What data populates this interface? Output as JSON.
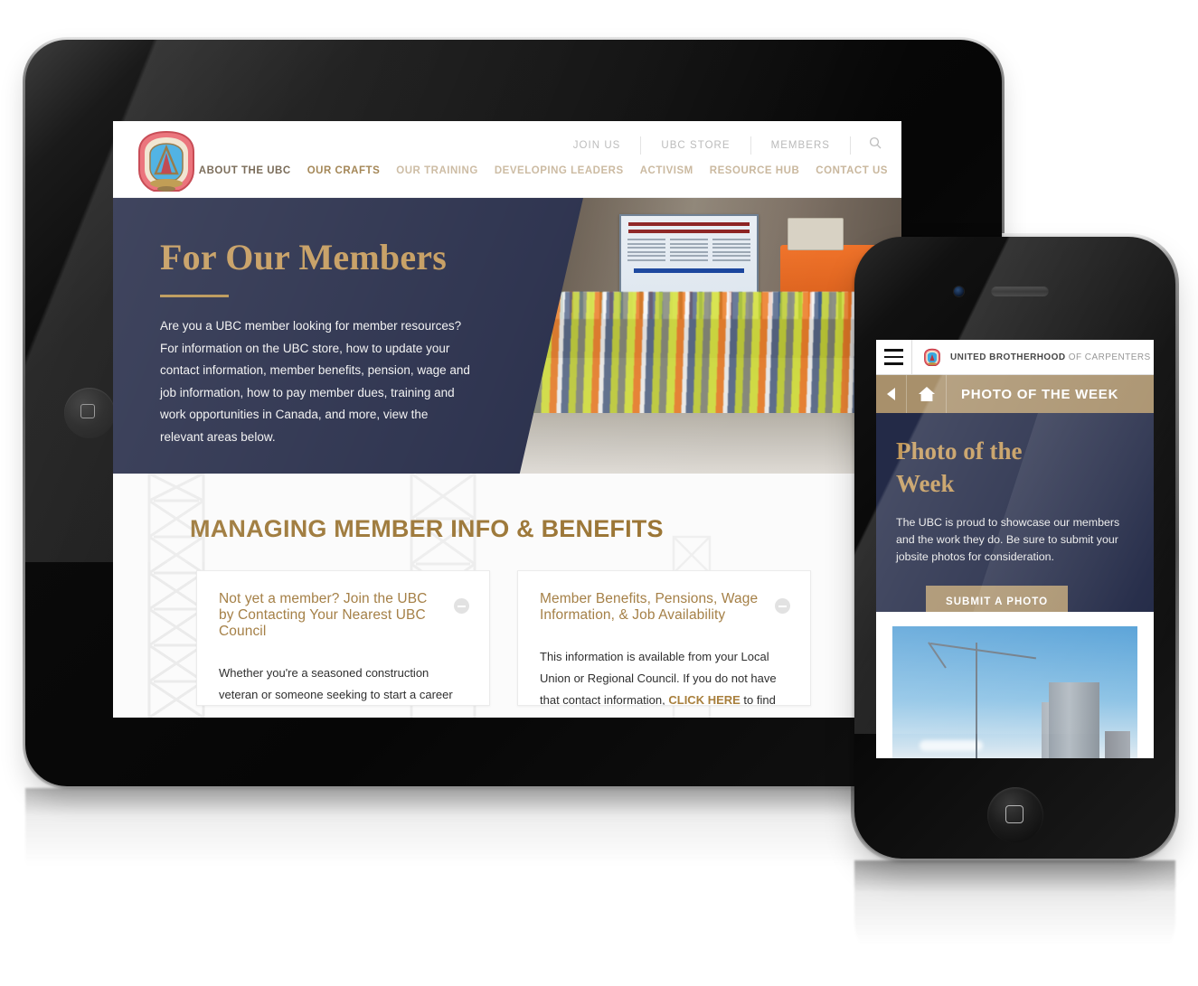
{
  "scene": {
    "description": "Responsive website mockup shown on a tablet and a smartphone",
    "devices": [
      "tablet",
      "phone"
    ]
  },
  "colors": {
    "navy": "#242a47",
    "gold": "#c49a5b",
    "bronze": "#a8906b",
    "heading_brown": "#9a7433",
    "card_title": "#a58047",
    "link_gold": "#a87f3c",
    "crest_red": "#e0575f",
    "crest_blue": "#3aa9e0"
  },
  "tablet": {
    "site_header": {
      "logo_name": "ubc-crest-logo",
      "top_links": [
        {
          "label": "JOIN US"
        },
        {
          "label": "UBC STORE"
        },
        {
          "label": "MEMBERS"
        }
      ],
      "search_icon": "search-icon",
      "main_nav": [
        {
          "label": "ABOUT THE UBC",
          "state": "dark"
        },
        {
          "label": "OUR CRAFTS",
          "state": "active"
        },
        {
          "label": "OUR TRAINING",
          "state": "normal"
        },
        {
          "label": "DEVELOPING LEADERS",
          "state": "normal"
        },
        {
          "label": "ACTIVISM",
          "state": "normal"
        },
        {
          "label": "RESOURCE HUB",
          "state": "normal"
        },
        {
          "label": "CONTACT US",
          "state": "normal"
        }
      ]
    },
    "hero": {
      "title": "For Our Members",
      "body": "Are you a UBC member looking for member resources? For information on the UBC store, how to update your contact information, member benefits, pension, wage and job information, how to pay member dues, training and work opportunities in Canada, and more, view the relevant areas below.",
      "photo_alt": "Large group of construction workers in hard hats and high-visibility vests posed in front of a memorial sign",
      "photo_sign_text": "WE WILL NEVER FORGET OUR FALLEN BROTHERS"
    },
    "section": {
      "heading": "MANAGING MEMBER INFO & BENEFITS",
      "cards": [
        {
          "title": "Not yet a member? Join the UBC by Contacting Your Nearest UBC Council",
          "body": "Whether you're a seasoned construction veteran or someone seeking to start a career through our acclaimed apprenticeship and",
          "toggle_icon": "minus-circle-icon"
        },
        {
          "title": "Member Benefits, Pensions, Wage Information, & Job Availability",
          "body_prefix": "This information is available from your Local Union or Regional Council. If you do not have that contact information, ",
          "body_link": "CLICK HERE",
          "body_suffix": " to find",
          "toggle_icon": "minus-circle-icon"
        }
      ]
    }
  },
  "phone": {
    "top_bar": {
      "menu_icon": "hamburger-menu-icon",
      "logo_name": "ubc-crest-logo",
      "brand_bold": "UNITED BROTHERHOOD",
      "brand_light": " OF CARPENTERS"
    },
    "nav_bar": {
      "back_icon": "back-arrow-icon",
      "home_icon": "home-icon",
      "title": "PHOTO OF THE WEEK"
    },
    "hero": {
      "title": "Photo of the Week",
      "body": "The UBC is proud to showcase our members and the work they do. Be sure to submit your jobsite photos for consideration.",
      "button_label": "SUBMIT A PHOTO"
    },
    "photo": {
      "alt": "Tower crane beside a concrete high-rise under construction against a blue sky"
    }
  }
}
